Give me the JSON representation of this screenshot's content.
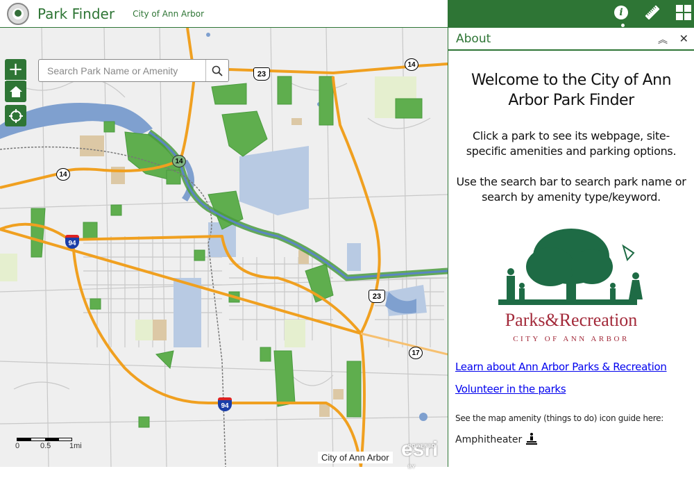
{
  "header": {
    "logo_alt": "City of Ann Arbor seal",
    "title": "Park Finder",
    "subtitle": "City of Ann Arbor",
    "brand_color": "#2e7535",
    "tools": [
      {
        "name": "info",
        "icon": "info-icon",
        "active": true
      },
      {
        "name": "measurement",
        "icon": "ruler-icon",
        "active": false
      },
      {
        "name": "apps",
        "icon": "grid-icon",
        "active": false
      }
    ]
  },
  "map": {
    "search": {
      "placeholder": "Search Park Name or Amenity",
      "value": ""
    },
    "controls": {
      "zoom_in": "+",
      "zoom_out": "−"
    },
    "route_shields": [
      {
        "type": "state",
        "label": "14"
      },
      {
        "type": "us",
        "label": "23"
      },
      {
        "type": "state",
        "label": "14"
      },
      {
        "type": "state",
        "label": "14"
      },
      {
        "type": "interstate",
        "label": "94"
      },
      {
        "type": "us",
        "label": "23"
      },
      {
        "type": "state",
        "label": "17"
      },
      {
        "type": "interstate",
        "label": "94"
      }
    ],
    "scale": {
      "labels": [
        "0",
        "0.5",
        "1mi"
      ]
    },
    "attribution": "City of Ann Arbor",
    "powered_by": "POWERED BY",
    "esri": "esri",
    "colors": {
      "park": "#5aa84a",
      "water": "#7fa0cf",
      "highway": "#f0a020",
      "university": "#b3c6e3",
      "school": "#d9c7a3"
    }
  },
  "panel": {
    "title": "About",
    "welcome": "Welcome to the City of Ann Arbor Park Finder",
    "paragraph1": "Click a park to see its webpage, site-specific amenities and parking options.",
    "paragraph2": "Use the search bar to search park name or search by amenity type/keyword.",
    "logo": {
      "title": "Parks&Recreation",
      "subtitle": "CITY OF ANN ARBOR"
    },
    "links": [
      "Learn about Ann Arbor Parks & Recreation",
      "Volunteer in the parks"
    ],
    "guide_text": "See the map amenity (things to do) icon guide here:",
    "amenities": [
      {
        "label": "Amphitheater"
      }
    ]
  }
}
